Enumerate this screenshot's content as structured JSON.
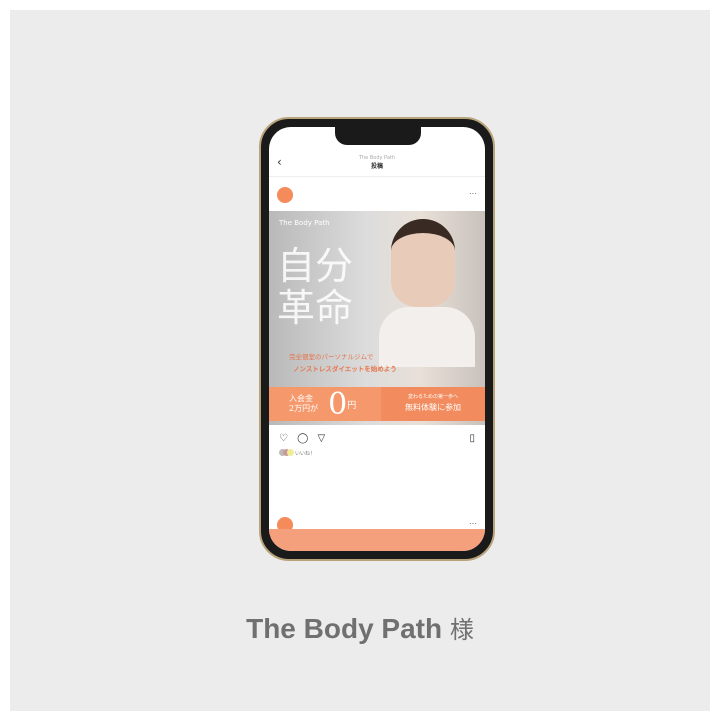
{
  "header": {
    "account": "The Body Path",
    "title": "投稿"
  },
  "post": {
    "brand": "The Body Path",
    "headline": "自分革命",
    "copy_line1": "完全個室のパーソナルジムで",
    "copy_line2": "ノンストレスダイエットを始めよう",
    "fee_label": "入会金",
    "fee_original": "2万円が",
    "fee_now": "0",
    "fee_unit": "円",
    "cta_sub": "変わるための第一歩へ",
    "cta_main": "無料体験に参加"
  },
  "likes_text": "いいね！",
  "caption": {
    "name": "The Body Path",
    "suffix": "様"
  },
  "colors": {
    "accent": "#f58a5a",
    "background": "#ececec"
  }
}
